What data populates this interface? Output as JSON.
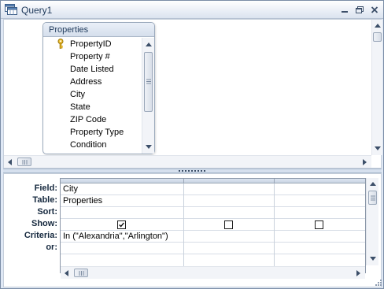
{
  "window": {
    "title": "Query1",
    "icon": "query-datasheet-icon",
    "controls": [
      "minimize-icon",
      "restore-icon",
      "close-icon"
    ]
  },
  "table_box": {
    "title": "Properties",
    "fields": [
      {
        "name": "PropertyID",
        "primary_key": true
      },
      {
        "name": "Property #"
      },
      {
        "name": "Date Listed"
      },
      {
        "name": "Address"
      },
      {
        "name": "City"
      },
      {
        "name": "State"
      },
      {
        "name": "ZIP Code"
      },
      {
        "name": "Property Type"
      },
      {
        "name": "Condition"
      }
    ]
  },
  "grid": {
    "row_labels": [
      "Field:",
      "Table:",
      "Sort:",
      "Show:",
      "Criteria:",
      "or:"
    ],
    "columns": [
      {
        "field": "City",
        "table": "Properties",
        "sort": "",
        "show": true,
        "criteria": "In (\"Alexandria\",\"Arlington\")",
        "or": ""
      },
      {
        "field": "",
        "table": "",
        "sort": "",
        "show": false,
        "criteria": "",
        "or": ""
      },
      {
        "field": "",
        "table": "",
        "sort": "",
        "show": false,
        "criteria": "",
        "or": ""
      }
    ]
  },
  "colors": {
    "title_text": "#1e395b",
    "pane_background": "#ffffff",
    "frame": "#dfe8f5",
    "splitter": "#d6e0ee"
  }
}
